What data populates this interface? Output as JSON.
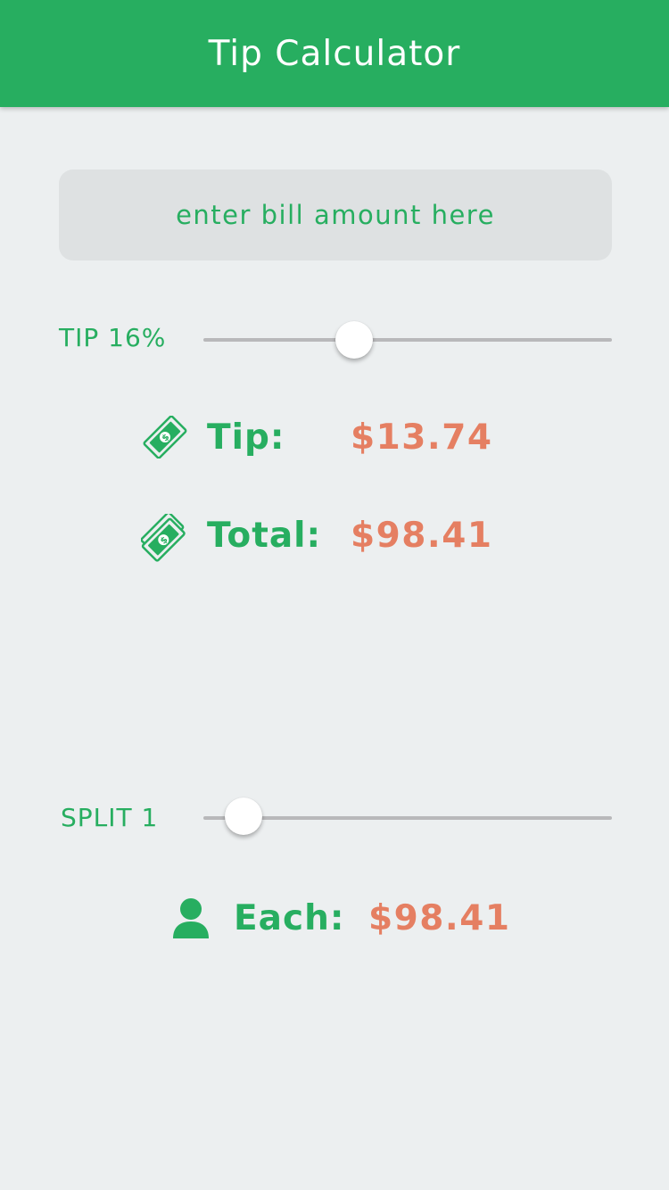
{
  "header": {
    "title": "Tip Calculator"
  },
  "bill": {
    "placeholder": "enter bill amount here",
    "value": ""
  },
  "tip_slider": {
    "label": "TIP 16%",
    "percent": 16
  },
  "tip_result": {
    "icon": "money-bill-icon",
    "label": "Tip:",
    "value": "$13.74"
  },
  "total_result": {
    "icon": "money-stack-icon",
    "label": "Total:",
    "value": "$98.41"
  },
  "split_slider": {
    "label": "SPLIT 1",
    "count": 1
  },
  "each_result": {
    "icon": "person-icon",
    "label": "Each:",
    "value": "$98.41"
  },
  "colors": {
    "accent": "#27AE60",
    "value": "#E57F62",
    "background": "#ECEFF0",
    "input_background": "#DEE1E2"
  }
}
